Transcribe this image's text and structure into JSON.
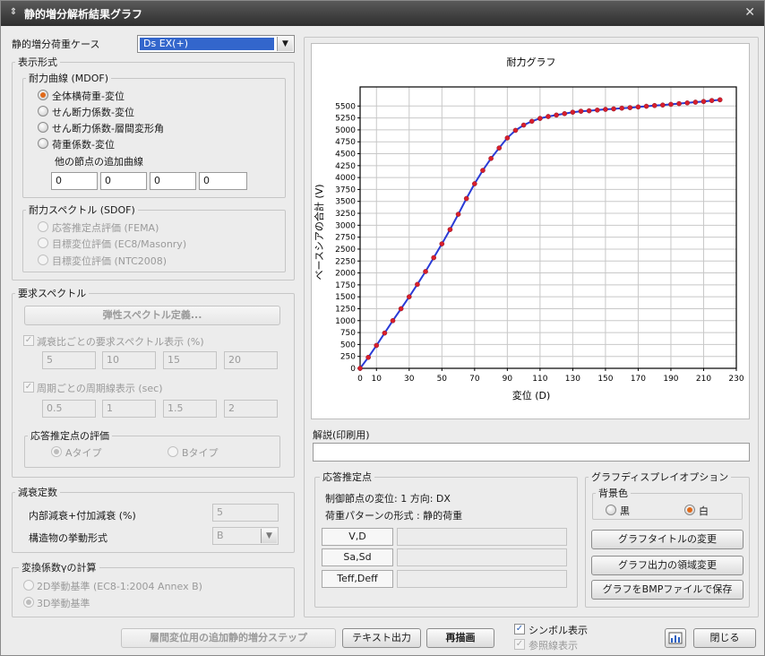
{
  "window": {
    "title": "静的増分解析結果グラフ",
    "app_icon": "chevron-icon",
    "close_icon": "close-icon"
  },
  "loadcase": {
    "label": "静的増分荷重ケース",
    "value": "Ds EX(+)"
  },
  "display": {
    "title": "表示形式",
    "mdof": {
      "title": "耐力曲線 (MDOF)",
      "options": [
        "全体横荷重-変位",
        "せん断力係数-変位",
        "せん断力係数-層間変形角",
        "荷重係数-変位"
      ],
      "selected_index": 0,
      "extra_label": "他の節点の追加曲線",
      "extra_values": [
        "0",
        "0",
        "0",
        "0"
      ]
    },
    "sdof": {
      "title": "耐力スペクトル (SDOF)",
      "options": [
        "応答推定点評価 (FEMA)",
        "目標変位評価 (EC8/Masonry)",
        "目標変位評価 (NTC2008)"
      ]
    }
  },
  "demand": {
    "title": "要求スペクトル",
    "elastic_button": "弾性スペクトル定義...",
    "damping_check": "減衰比ごとの要求スペクトル表示 (%)",
    "damping_values": [
      "5",
      "10",
      "15",
      "20"
    ],
    "period_check": "周期ごとの周期線表示 (sec)",
    "period_values": [
      "0.5",
      "1",
      "1.5",
      "2"
    ],
    "eval": {
      "title": "応答推定点の評価",
      "option_a": "Aタイプ",
      "option_b": "Bタイプ"
    }
  },
  "damping": {
    "title": "減衰定数",
    "internal_label": "内部減衰+付加減衰 (%)",
    "internal_value": "5",
    "behavior_label": "構造物の挙動形式",
    "behavior_value": "B"
  },
  "gamma": {
    "title": "変換係数γの計算",
    "option_2d": "2D挙動基準 (EC8-1:2004  Annex B)",
    "option_3d": "3D挙動基準"
  },
  "chart_data": {
    "type": "line",
    "title": "耐力グラフ",
    "xlabel": "変位 (D)",
    "ylabel": "ベースシアの合計 (V)",
    "xlim": [
      0,
      230
    ],
    "ylim": [
      0,
      5900
    ],
    "xticks": [
      0,
      10,
      30,
      50,
      70,
      90,
      110,
      130,
      150,
      170,
      190,
      210,
      230
    ],
    "yticks": [
      0,
      250,
      500,
      750,
      1000,
      1250,
      1500,
      1750,
      2000,
      2250,
      2500,
      2750,
      3000,
      3250,
      3500,
      3750,
      4000,
      4250,
      4500,
      4750,
      5000,
      5250,
      5500
    ],
    "grid": true,
    "line_color": "#2a3bd6",
    "marker_color": "#d81e2c",
    "points": [
      [
        0,
        0
      ],
      [
        5,
        230
      ],
      [
        10,
        480
      ],
      [
        15,
        740
      ],
      [
        20,
        1000
      ],
      [
        25,
        1250
      ],
      [
        30,
        1500
      ],
      [
        35,
        1760
      ],
      [
        40,
        2030
      ],
      [
        45,
        2320
      ],
      [
        50,
        2610
      ],
      [
        55,
        2910
      ],
      [
        60,
        3230
      ],
      [
        65,
        3560
      ],
      [
        70,
        3870
      ],
      [
        75,
        4150
      ],
      [
        80,
        4400
      ],
      [
        85,
        4620
      ],
      [
        90,
        4830
      ],
      [
        95,
        4990
      ],
      [
        100,
        5100
      ],
      [
        105,
        5180
      ],
      [
        110,
        5240
      ],
      [
        115,
        5280
      ],
      [
        120,
        5310
      ],
      [
        125,
        5340
      ],
      [
        130,
        5370
      ],
      [
        135,
        5390
      ],
      [
        140,
        5400
      ],
      [
        145,
        5415
      ],
      [
        150,
        5430
      ],
      [
        155,
        5440
      ],
      [
        160,
        5455
      ],
      [
        165,
        5465
      ],
      [
        170,
        5480
      ],
      [
        175,
        5495
      ],
      [
        180,
        5510
      ],
      [
        185,
        5520
      ],
      [
        190,
        5535
      ],
      [
        195,
        5550
      ],
      [
        200,
        5565
      ],
      [
        205,
        5580
      ],
      [
        210,
        5595
      ],
      [
        215,
        5615
      ],
      [
        220,
        5630
      ]
    ]
  },
  "explanation": {
    "label": "解説(印刷用)",
    "value": ""
  },
  "response": {
    "title": "応答推定点",
    "line1": "制御節点の変位: 1  方向: DX",
    "line2": "荷重パターンの形式 : 静的荷重",
    "rows": [
      "V,D",
      "Sa,Sd",
      "Teff,Deff"
    ]
  },
  "graph_options": {
    "title": "グラフディスプレイオプション",
    "bg_title": "背景色",
    "bg_black": "黒",
    "bg_white": "白",
    "change_title_button": "グラフタイトルの変更",
    "change_area_button": "グラフ出力の領域変更",
    "save_bmp_button": "グラフをBMPファイルで保存"
  },
  "footer": {
    "additional_steps_button": "層間変位用の追加静的増分ステップ",
    "text_output_button": "テキスト出力",
    "redraw_button": "再描画",
    "symbol_check": "シンボル表示",
    "ref_line_check": "参照線表示",
    "chart_icon": "bar-chart-icon",
    "close_button": "閉じる"
  }
}
